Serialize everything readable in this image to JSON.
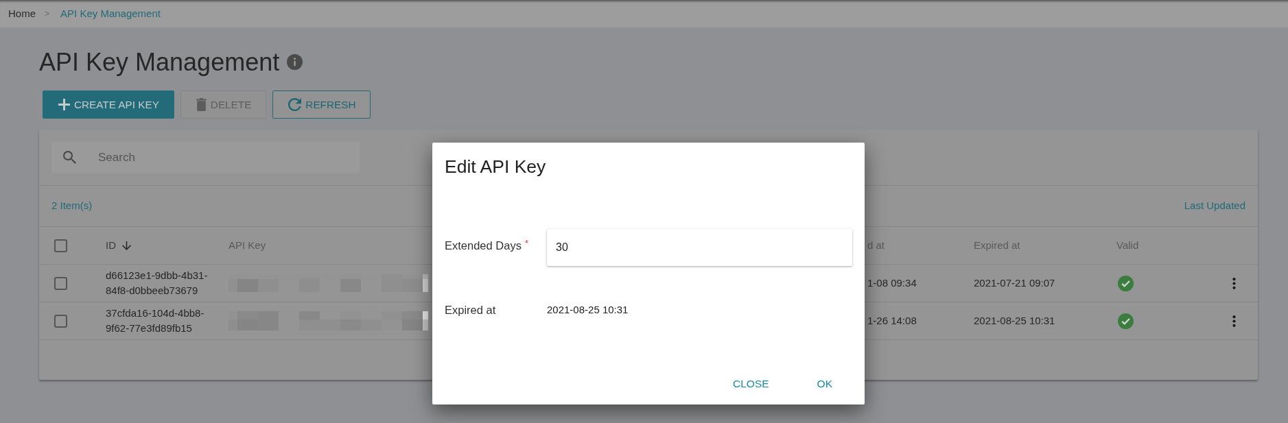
{
  "breadcrumb": {
    "separator": ">",
    "items": [
      {
        "label": "Home",
        "current": false
      },
      {
        "label": "API Key Management",
        "current": true
      }
    ]
  },
  "page": {
    "title": "API Key Management"
  },
  "toolbar": [
    {
      "kind": "create",
      "label": "CREATE API KEY",
      "disabled": false
    },
    {
      "kind": "delete",
      "label": "DELETE",
      "disabled": true
    },
    {
      "kind": "refresh",
      "label": "REFRESH",
      "disabled": false
    }
  ],
  "table": {
    "search": {
      "placeholder": "Search"
    },
    "count": "2 Item(s)",
    "sort_link": "Last Updated",
    "select_all_checked": false,
    "columns": [
      {
        "label": "ID",
        "sorted": true,
        "descending": true
      },
      {
        "label": "API Key",
        "sorted": false
      },
      {
        "label": "d at",
        "sorted": false
      },
      {
        "label": "Expired at",
        "sorted": false
      },
      {
        "label": "Valid",
        "sorted": false
      }
    ],
    "rows": [
      {
        "checked": false,
        "id": "d66123e1-9dbb-4b31-84f8-d0bbeeb73679",
        "column_3": "1-08 09:34",
        "expired_at": "2021-07-21 09:07",
        "valid": true
      },
      {
        "checked": false,
        "id": "37cfda16-104d-4bb8-9f62-77e3fd89fb15",
        "column_3": "1-26 14:08",
        "expired_at": "2021-08-25 10:31",
        "valid": true
      }
    ]
  },
  "dialog": {
    "title": "Edit API Key",
    "fields": [
      {
        "kind": "input",
        "label": "Extended Days",
        "required_mark": "*",
        "value": "30"
      },
      {
        "kind": "readonly",
        "label": "Expired at",
        "value": "2021-08-25 10:31"
      }
    ],
    "buttons": [
      {
        "label": "CLOSE"
      },
      {
        "label": "OK"
      }
    ]
  }
}
